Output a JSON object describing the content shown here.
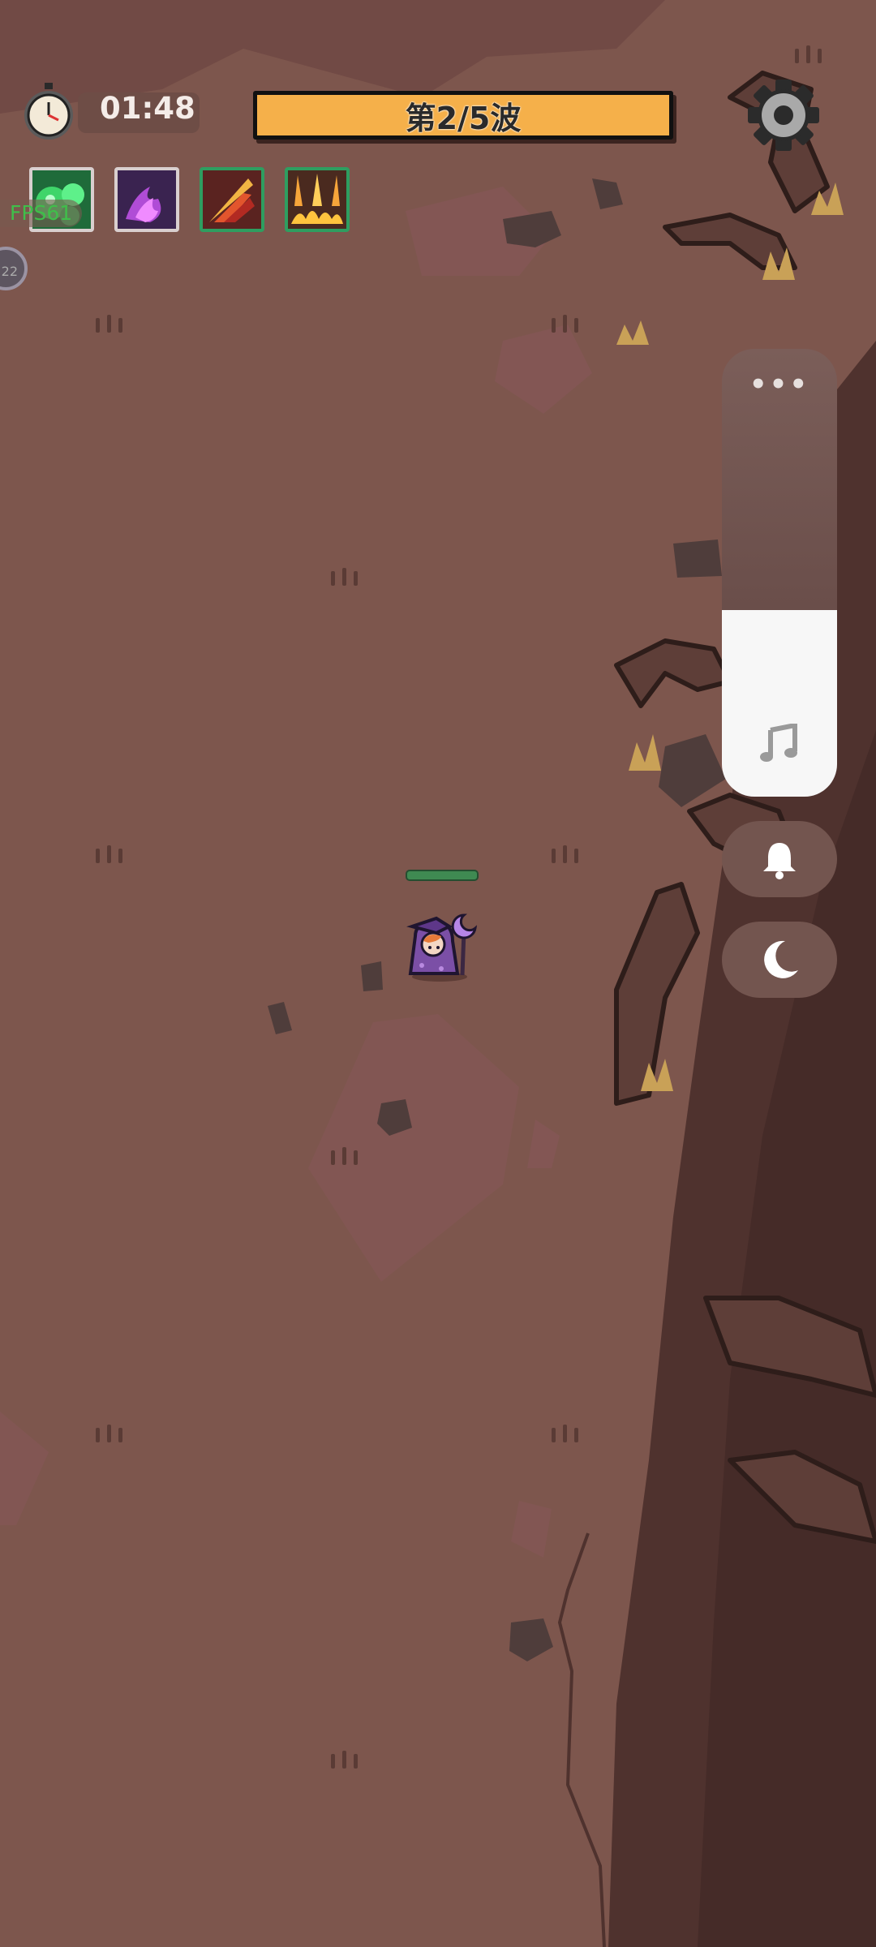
{
  "hud": {
    "timer": "01:48",
    "wave_label": "第2/5波",
    "fps_label": "FPS61",
    "side_bubble_text": "22"
  },
  "skills": [
    {
      "icon": "green-slime-skill-icon"
    },
    {
      "icon": "purple-flame-skill-icon"
    },
    {
      "icon": "fire-arrow-skill-icon"
    },
    {
      "icon": "fire-rain-skill-icon"
    }
  ],
  "side_panel": {
    "more_label": "•••",
    "buttons": [
      "music-note-icon",
      "bell-icon",
      "moon-icon"
    ]
  },
  "player": {
    "health": 1.0,
    "character": "purple-wizard"
  },
  "colors": {
    "ground": "#7d564d",
    "wave_bar": "#f5b04a",
    "health": "#3f8a52",
    "wizard_robe": "#7b4fa6"
  }
}
